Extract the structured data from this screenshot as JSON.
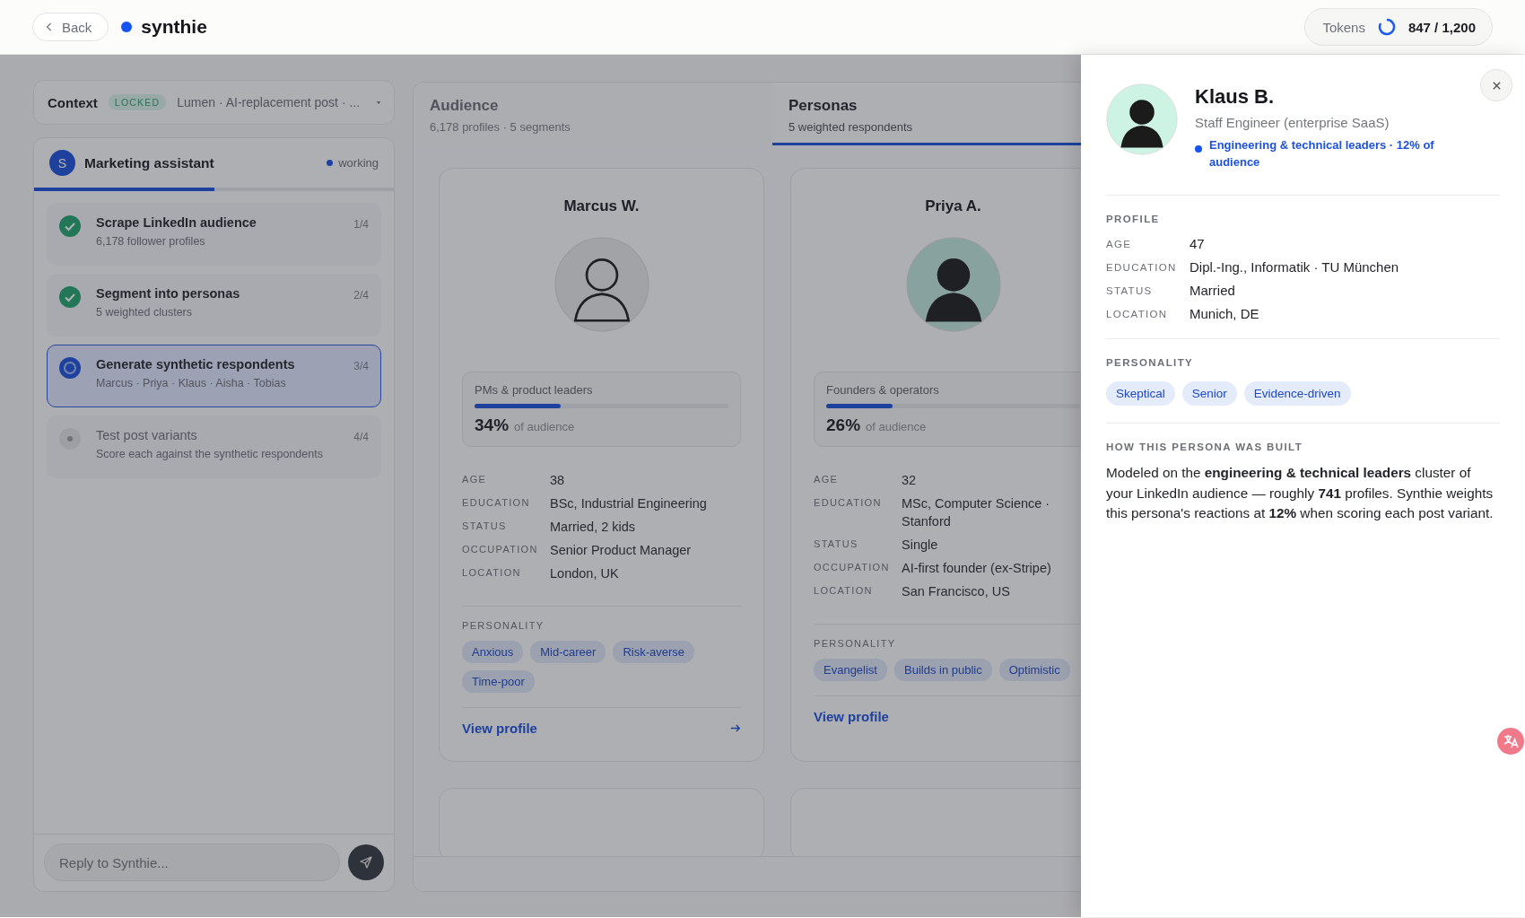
{
  "header": {
    "back_label": "Back",
    "brand": "synthie",
    "tokens": {
      "label": "Tokens",
      "value": "847 / 1,200"
    }
  },
  "context": {
    "title": "Context",
    "badge": "LOCKED",
    "summary": "Lumen · AI-replacement post · ..."
  },
  "assistant": {
    "avatar": "S",
    "name": "Marketing assistant",
    "status": "working",
    "level": 0.5,
    "steps": [
      {
        "title": "Scrape LinkedIn audience",
        "subtitle": "6,178 follower profiles",
        "count": "1/4",
        "kind": "done",
        "selected": false
      },
      {
        "title": "Segment into personas",
        "subtitle": "5 weighted clusters",
        "count": "2/4",
        "kind": "done",
        "selected": false
      },
      {
        "title": "Generate synthetic respondents",
        "subtitle": "Marcus · Priya · Klaus · Aisha · Tobias",
        "count": "3/4",
        "kind": "active",
        "selected": true
      },
      {
        "title": "Test post variants",
        "subtitle": "Score each against the synthetic respondents",
        "count": "4/4",
        "kind": "pending",
        "selected": false
      }
    ],
    "reply": {
      "placeholder": "Reply to Synthie..."
    }
  },
  "tabs": [
    {
      "title": "Audience",
      "subtitle": "6,178 profiles · 5 segments",
      "selected": false
    },
    {
      "title": "Personas",
      "subtitle": "5 weighted respondents",
      "selected": true
    }
  ],
  "personas": [
    {
      "name": "Marcus W.",
      "kind": "outline",
      "segment": "PMs & product leaders",
      "level": 0.34,
      "share": "34%",
      "share_note": "of audience",
      "details": [
        {
          "label": "AGE",
          "value": "38"
        },
        {
          "label": "EDUCATION",
          "value": "BSc, Industrial Engineering"
        },
        {
          "label": "STATUS",
          "value": "Married, 2 kids"
        },
        {
          "label": "OCCUPATION",
          "value": "Senior Product Manager"
        },
        {
          "label": "LOCATION",
          "value": "London, UK"
        }
      ],
      "personality_label": "PERSONALITY",
      "traits": [
        "Anxious",
        "Mid-career",
        "Risk-averse",
        "Time-poor"
      ],
      "link": "View profile",
      "arrow": true
    },
    {
      "name": "Priya A.",
      "kind": "tinted",
      "segment": "Founders & operators",
      "level": 0.26,
      "share": "26%",
      "share_note": "of audience",
      "details": [
        {
          "label": "AGE",
          "value": "32"
        },
        {
          "label": "EDUCATION",
          "value": "MSc, Computer Science · Stanford"
        },
        {
          "label": "STATUS",
          "value": "Single"
        },
        {
          "label": "OCCUPATION",
          "value": "AI-first founder (ex-Stripe)"
        },
        {
          "label": "LOCATION",
          "value": "San Francisco, US"
        }
      ],
      "personality_label": "PERSONALITY",
      "traits": [
        "Evangelist",
        "Builds in public",
        "Optimistic"
      ],
      "link": "View profile",
      "arrow": false
    }
  ],
  "drawer": {
    "name": "Klaus B.",
    "role": "Staff Engineer (enterprise SaaS)",
    "segment": "Engineering & technical leaders · 12% of audience",
    "profile_label": "PROFILE",
    "details": [
      {
        "label": "AGE",
        "value": "47"
      },
      {
        "label": "EDUCATION",
        "value": "Dipl.-Ing., Informatik · TU München"
      },
      {
        "label": "STATUS",
        "value": "Married"
      },
      {
        "label": "LOCATION",
        "value": "Munich, DE"
      }
    ],
    "personality_label": "PERSONALITY",
    "traits": [
      "Skeptical",
      "Senior",
      "Evidence-driven"
    ],
    "built_label": "HOW THIS PERSONA WAS BUILT",
    "built_text": "Modeled on the **engineering & technical leaders** cluster of your LinkedIn audience — roughly **741** profiles. Synthie weights this persona's reactions at **12%** when scoring each post variant."
  }
}
